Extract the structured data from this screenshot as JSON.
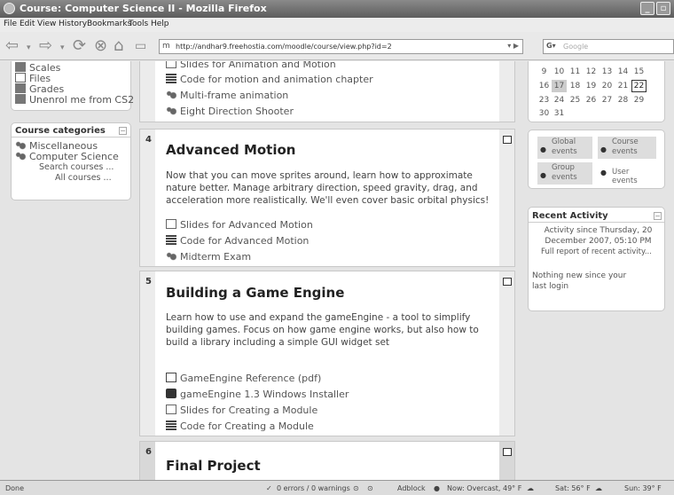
{
  "window": {
    "title": "Course: Computer Science II - Mozilla Firefox"
  },
  "menu": [
    "File",
    "Edit",
    "View",
    "History",
    "Bookmarks",
    "Tools",
    "Help"
  ],
  "nav": {
    "url": "http://andhar9.freehostia.com/moodle/course/view.php?id=2",
    "search_placeholder": "Google"
  },
  "left": {
    "admin_items": [
      "Scales",
      "Files",
      "Grades",
      "Unenrol me from CS2"
    ],
    "categories": {
      "header": "Course categories",
      "items": [
        "Miscellaneous",
        "Computer Science"
      ],
      "search_link": "Search courses ...",
      "all_link": "All courses ..."
    }
  },
  "top_items": [
    {
      "icon": "slides",
      "label": "Slides for Animation and Motion"
    },
    {
      "icon": "code",
      "label": "Code for motion and animation chapter"
    },
    {
      "icon": "forum",
      "label": "Multi-frame animation"
    },
    {
      "icon": "forum",
      "label": "Eight Direction Shooter"
    }
  ],
  "sections": [
    {
      "number": "4",
      "title": "Advanced Motion",
      "description": "Now that you can move sprites around, learn how to approximate nature better. Manage arbitrary direction, speed gravity, drag, and acceleration more realistically. We'll even cover basic orbital physics!",
      "items": [
        {
          "icon": "slides",
          "label": "Slides for Advanced Motion"
        },
        {
          "icon": "code",
          "label": "Code for Advanced Motion"
        },
        {
          "icon": "forum",
          "label": "Midterm Exam"
        }
      ]
    },
    {
      "number": "5",
      "title": "Building a Game Engine",
      "description": "Learn how to use and expand the gameEngine - a tool to simplify building games. Focus on how game engine works, but also how to build a library including a simple GUI widget set",
      "items": [
        {
          "icon": "pdf",
          "label": "GameEngine Reference (pdf)"
        },
        {
          "icon": "install",
          "label": "gameEngine 1.3 Windows Installer"
        },
        {
          "icon": "slides",
          "label": "Slides for Creating a Module"
        },
        {
          "icon": "code",
          "label": "Code for Creating a Module"
        }
      ]
    },
    {
      "number": "6",
      "title": "Final Project"
    }
  ],
  "calendar": {
    "rows": [
      [
        "9",
        "10",
        "11",
        "12",
        "13",
        "14",
        "15"
      ],
      [
        "16",
        "17",
        "18",
        "19",
        "20",
        "21",
        "22"
      ],
      [
        "23",
        "24",
        "25",
        "26",
        "27",
        "28",
        "29"
      ],
      [
        "30",
        "31"
      ]
    ],
    "highlight": "17",
    "today": "22"
  },
  "events": {
    "global": "Global events",
    "course": "Course events",
    "group": "Group events",
    "user": "User events"
  },
  "recent": {
    "header": "Recent Activity",
    "since": "Activity since Thursday, 20 December 2007, 05:10 PM",
    "full_report": "Full report of recent activity...",
    "nothing": "Nothing new since your last login"
  },
  "status": {
    "left": "Done",
    "errors": "0 errors / 0 warnings",
    "adblock": "Adblock",
    "weather_now": "Now: Overcast, 49° F",
    "sat": "Sat: 56° F",
    "sun": "Sun: 39° F"
  }
}
